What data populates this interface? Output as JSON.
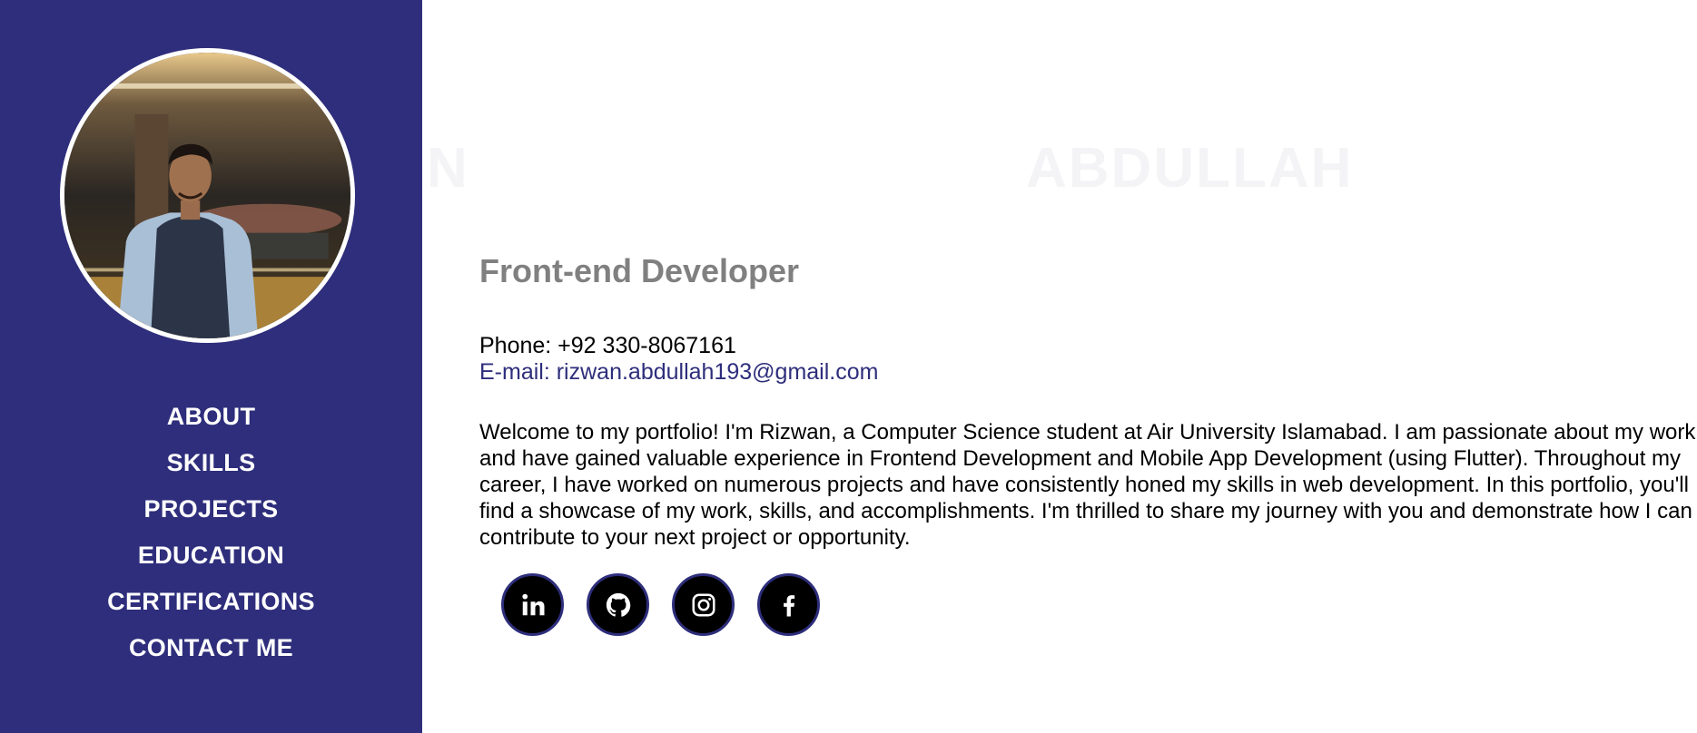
{
  "sidebar": {
    "nav": [
      {
        "label": "ABOUT"
      },
      {
        "label": "SKILLS"
      },
      {
        "label": "PROJECTS"
      },
      {
        "label": "EDUCATION"
      },
      {
        "label": "CERTIFICATIONS"
      },
      {
        "label": "CONTACT ME"
      }
    ]
  },
  "hero": {
    "bg_first": "N",
    "bg_last": "ABDULLAH",
    "role": "Front-end Developer",
    "phone": "Phone: +92 330-8067161",
    "email": "E-mail: rizwan.abdullah193@gmail.com",
    "bio": "Welcome to my portfolio! I'm Rizwan, a Computer Science student at Air University Islamabad. I am passionate about my work and have gained valuable experience in Frontend Development and Mobile App Development (using Flutter). Throughout my career, I have worked on numerous projects and have consistently honed my skills in web development. In this portfolio, you'll find a showcase of my work, skills, and accomplishments. I'm thrilled to share my journey with you and demonstrate how I can contribute to your next project or opportunity."
  },
  "socials": [
    {
      "icon": "linkedin-icon"
    },
    {
      "icon": "github-icon"
    },
    {
      "icon": "instagram-icon"
    },
    {
      "icon": "facebook-icon"
    }
  ],
  "colors": {
    "sidebar_bg": "#2e2e7c",
    "accent": "#2e2e7c",
    "role_text": "#808080",
    "social_bg": "#000000"
  }
}
